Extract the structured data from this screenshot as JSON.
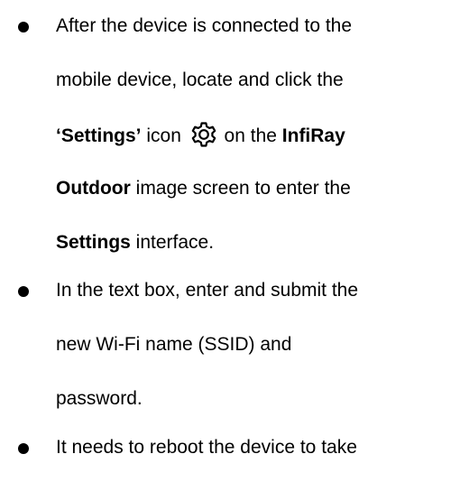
{
  "items": [
    {
      "lines": [
        {
          "text": "After the device is connected to the"
        },
        {
          "text": "mobile device, locate and click the"
        },
        {
          "settings_quoted": "‘Settings’",
          "icon_prefix": " icon ",
          "icon": "gear-icon",
          "after_icon": " on the ",
          "app_name_part1": "InfiRay"
        },
        {
          "app_name_part2": "Outdoor",
          "text": " image screen to enter the"
        },
        {
          "settings": "Settings",
          "text": " interface."
        }
      ]
    },
    {
      "lines": [
        {
          "text": "In the text box, enter and submit the"
        },
        {
          "text": "new Wi-Fi name (SSID) and"
        },
        {
          "text": "password."
        }
      ]
    },
    {
      "lines": [
        {
          "text": "It needs to reboot the device to take"
        }
      ]
    }
  ]
}
